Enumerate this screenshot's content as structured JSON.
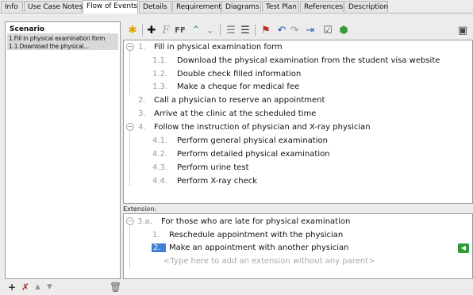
{
  "tabs": [
    "Info",
    "Use Case Notes",
    "Flow of Events",
    "Details",
    "Requirements",
    "Diagrams",
    "Test Plan",
    "References",
    "Description"
  ],
  "active_tab": "Flow of Events",
  "scenario_panel": {
    "title": "Scenario",
    "items": [
      "1.Fill in physical examination form",
      "1.1.Download the physical..."
    ]
  },
  "steps": [
    {
      "num": "1.",
      "text": "Fill in physical examination form"
    },
    {
      "num": "1.1.",
      "text": "Download the physical examination from the student visa website"
    },
    {
      "num": "1.2.",
      "text": "Double check filled information"
    },
    {
      "num": "1.3.",
      "text": "Make a cheque for medical fee"
    },
    {
      "num": "2.",
      "text": "Call a physician to reserve an appointment"
    },
    {
      "num": "3.",
      "text": "Arrive at the clinic at the scheduled time"
    },
    {
      "num": "4.",
      "text": "Follow the instruction of physician and X-ray physician"
    },
    {
      "num": "4.1.",
      "text": "Perform general physical examination"
    },
    {
      "num": "4.2.",
      "text": "Perform detailed physical examination"
    },
    {
      "num": "4.3.",
      "text": "Perform urine test"
    },
    {
      "num": "4.4.",
      "text": "Perform X-ray check"
    }
  ],
  "extension": {
    "label": "Extension:",
    "header_num": "3.a.",
    "header_text": "For those who are late for physical examination",
    "items": [
      {
        "num": "1.",
        "text": "Reschedule appointment with the physician"
      },
      {
        "num": "2.",
        "text": "Make an appointment with another physician"
      }
    ],
    "placeholder": "<Type here to add an extension without any parent>"
  },
  "colors": {
    "selection": "#3d7fd9",
    "green_button": "#2e9a3a"
  }
}
